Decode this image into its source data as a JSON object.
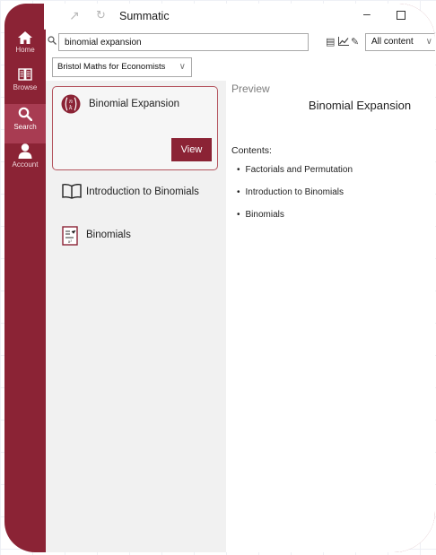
{
  "app": {
    "title": "Summatic"
  },
  "nav": [
    {
      "label": "Home",
      "icon": "home-icon"
    },
    {
      "label": "Browse",
      "icon": "book-open-icon"
    },
    {
      "label": "Search",
      "icon": "search-icon"
    },
    {
      "label": "Account",
      "icon": "user-icon"
    }
  ],
  "search": {
    "query": "binomial expansion",
    "scope": "All content"
  },
  "filter": {
    "book": "Bristol Maths for Economists"
  },
  "results": [
    {
      "name": "Binomial Expansion",
      "icon": "binomial-coefficient-icon",
      "action": "View",
      "selected": true
    },
    {
      "name": "Introduction to Binomials",
      "icon": "open-book-icon"
    },
    {
      "name": "Binomials",
      "icon": "worksheet-icon"
    }
  ],
  "preview": {
    "heading": "Preview",
    "title": "Binomial Expansion",
    "contents_label": "Contents:",
    "items": [
      "Factorials and Permutation",
      "Introduction to Binomials",
      "Binomials"
    ]
  },
  "colors": {
    "brand": "#8b2335",
    "brand_active": "#a83c52",
    "card_border": "#b4545e"
  }
}
